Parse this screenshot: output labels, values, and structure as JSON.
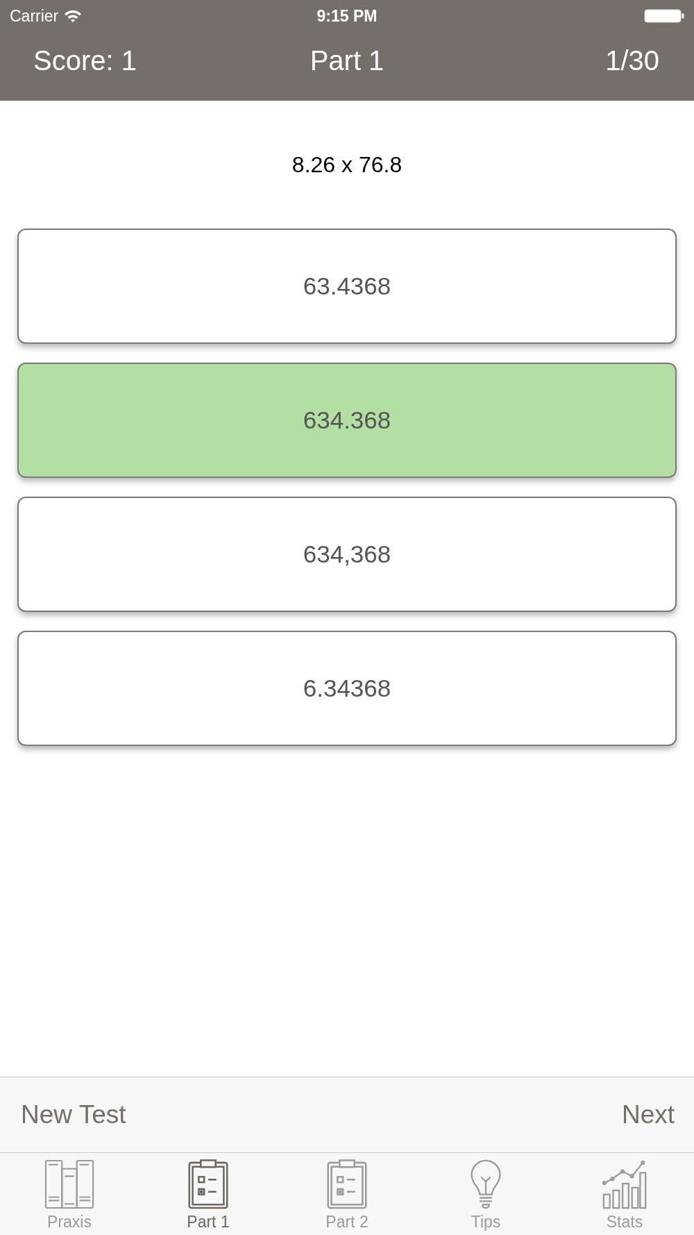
{
  "status_bar": {
    "carrier": "Carrier",
    "time": "9:15 PM"
  },
  "nav_bar": {
    "score": "Score: 1",
    "title": "Part 1",
    "progress": "1/30"
  },
  "question": "8.26 x 76.8",
  "answers": [
    {
      "text": "63.4368",
      "selected": false
    },
    {
      "text": "634.368",
      "selected": true
    },
    {
      "text": "634,368",
      "selected": false
    },
    {
      "text": "6.34368",
      "selected": false
    }
  ],
  "toolbar": {
    "left": "New Test",
    "right": "Next"
  },
  "tabs": [
    {
      "label": "Praxis",
      "kind": "books",
      "selected": false
    },
    {
      "label": "Part 1",
      "kind": "clipboard",
      "selected": true
    },
    {
      "label": "Part 2",
      "kind": "clipboard",
      "selected": false
    },
    {
      "label": "Tips",
      "kind": "bulb",
      "selected": false
    },
    {
      "label": "Stats",
      "kind": "chart",
      "selected": false
    }
  ]
}
